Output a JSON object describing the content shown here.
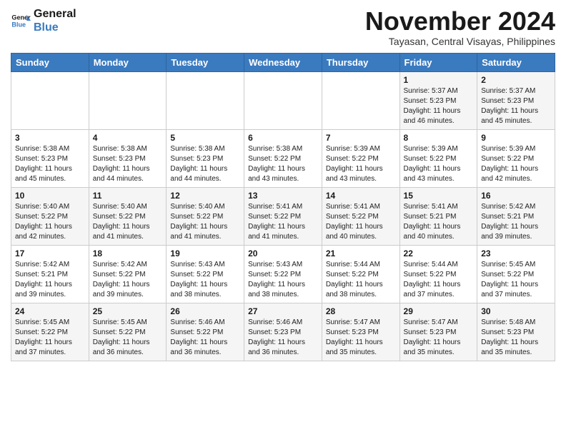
{
  "header": {
    "logo_line1": "General",
    "logo_line2": "Blue",
    "month": "November 2024",
    "location": "Tayasan, Central Visayas, Philippines"
  },
  "columns": [
    "Sunday",
    "Monday",
    "Tuesday",
    "Wednesday",
    "Thursday",
    "Friday",
    "Saturday"
  ],
  "weeks": [
    {
      "days": [
        {
          "date": "",
          "info": ""
        },
        {
          "date": "",
          "info": ""
        },
        {
          "date": "",
          "info": ""
        },
        {
          "date": "",
          "info": ""
        },
        {
          "date": "",
          "info": ""
        },
        {
          "date": "1",
          "info": "Sunrise: 5:37 AM\nSunset: 5:23 PM\nDaylight: 11 hours\nand 46 minutes."
        },
        {
          "date": "2",
          "info": "Sunrise: 5:37 AM\nSunset: 5:23 PM\nDaylight: 11 hours\nand 45 minutes."
        }
      ]
    },
    {
      "days": [
        {
          "date": "3",
          "info": "Sunrise: 5:38 AM\nSunset: 5:23 PM\nDaylight: 11 hours\nand 45 minutes."
        },
        {
          "date": "4",
          "info": "Sunrise: 5:38 AM\nSunset: 5:23 PM\nDaylight: 11 hours\nand 44 minutes."
        },
        {
          "date": "5",
          "info": "Sunrise: 5:38 AM\nSunset: 5:23 PM\nDaylight: 11 hours\nand 44 minutes."
        },
        {
          "date": "6",
          "info": "Sunrise: 5:38 AM\nSunset: 5:22 PM\nDaylight: 11 hours\nand 43 minutes."
        },
        {
          "date": "7",
          "info": "Sunrise: 5:39 AM\nSunset: 5:22 PM\nDaylight: 11 hours\nand 43 minutes."
        },
        {
          "date": "8",
          "info": "Sunrise: 5:39 AM\nSunset: 5:22 PM\nDaylight: 11 hours\nand 43 minutes."
        },
        {
          "date": "9",
          "info": "Sunrise: 5:39 AM\nSunset: 5:22 PM\nDaylight: 11 hours\nand 42 minutes."
        }
      ]
    },
    {
      "days": [
        {
          "date": "10",
          "info": "Sunrise: 5:40 AM\nSunset: 5:22 PM\nDaylight: 11 hours\nand 42 minutes."
        },
        {
          "date": "11",
          "info": "Sunrise: 5:40 AM\nSunset: 5:22 PM\nDaylight: 11 hours\nand 41 minutes."
        },
        {
          "date": "12",
          "info": "Sunrise: 5:40 AM\nSunset: 5:22 PM\nDaylight: 11 hours\nand 41 minutes."
        },
        {
          "date": "13",
          "info": "Sunrise: 5:41 AM\nSunset: 5:22 PM\nDaylight: 11 hours\nand 41 minutes."
        },
        {
          "date": "14",
          "info": "Sunrise: 5:41 AM\nSunset: 5:22 PM\nDaylight: 11 hours\nand 40 minutes."
        },
        {
          "date": "15",
          "info": "Sunrise: 5:41 AM\nSunset: 5:21 PM\nDaylight: 11 hours\nand 40 minutes."
        },
        {
          "date": "16",
          "info": "Sunrise: 5:42 AM\nSunset: 5:21 PM\nDaylight: 11 hours\nand 39 minutes."
        }
      ]
    },
    {
      "days": [
        {
          "date": "17",
          "info": "Sunrise: 5:42 AM\nSunset: 5:21 PM\nDaylight: 11 hours\nand 39 minutes."
        },
        {
          "date": "18",
          "info": "Sunrise: 5:42 AM\nSunset: 5:22 PM\nDaylight: 11 hours\nand 39 minutes."
        },
        {
          "date": "19",
          "info": "Sunrise: 5:43 AM\nSunset: 5:22 PM\nDaylight: 11 hours\nand 38 minutes."
        },
        {
          "date": "20",
          "info": "Sunrise: 5:43 AM\nSunset: 5:22 PM\nDaylight: 11 hours\nand 38 minutes."
        },
        {
          "date": "21",
          "info": "Sunrise: 5:44 AM\nSunset: 5:22 PM\nDaylight: 11 hours\nand 38 minutes."
        },
        {
          "date": "22",
          "info": "Sunrise: 5:44 AM\nSunset: 5:22 PM\nDaylight: 11 hours\nand 37 minutes."
        },
        {
          "date": "23",
          "info": "Sunrise: 5:45 AM\nSunset: 5:22 PM\nDaylight: 11 hours\nand 37 minutes."
        }
      ]
    },
    {
      "days": [
        {
          "date": "24",
          "info": "Sunrise: 5:45 AM\nSunset: 5:22 PM\nDaylight: 11 hours\nand 37 minutes."
        },
        {
          "date": "25",
          "info": "Sunrise: 5:45 AM\nSunset: 5:22 PM\nDaylight: 11 hours\nand 36 minutes."
        },
        {
          "date": "26",
          "info": "Sunrise: 5:46 AM\nSunset: 5:22 PM\nDaylight: 11 hours\nand 36 minutes."
        },
        {
          "date": "27",
          "info": "Sunrise: 5:46 AM\nSunset: 5:23 PM\nDaylight: 11 hours\nand 36 minutes."
        },
        {
          "date": "28",
          "info": "Sunrise: 5:47 AM\nSunset: 5:23 PM\nDaylight: 11 hours\nand 35 minutes."
        },
        {
          "date": "29",
          "info": "Sunrise: 5:47 AM\nSunset: 5:23 PM\nDaylight: 11 hours\nand 35 minutes."
        },
        {
          "date": "30",
          "info": "Sunrise: 5:48 AM\nSunset: 5:23 PM\nDaylight: 11 hours\nand 35 minutes."
        }
      ]
    }
  ]
}
